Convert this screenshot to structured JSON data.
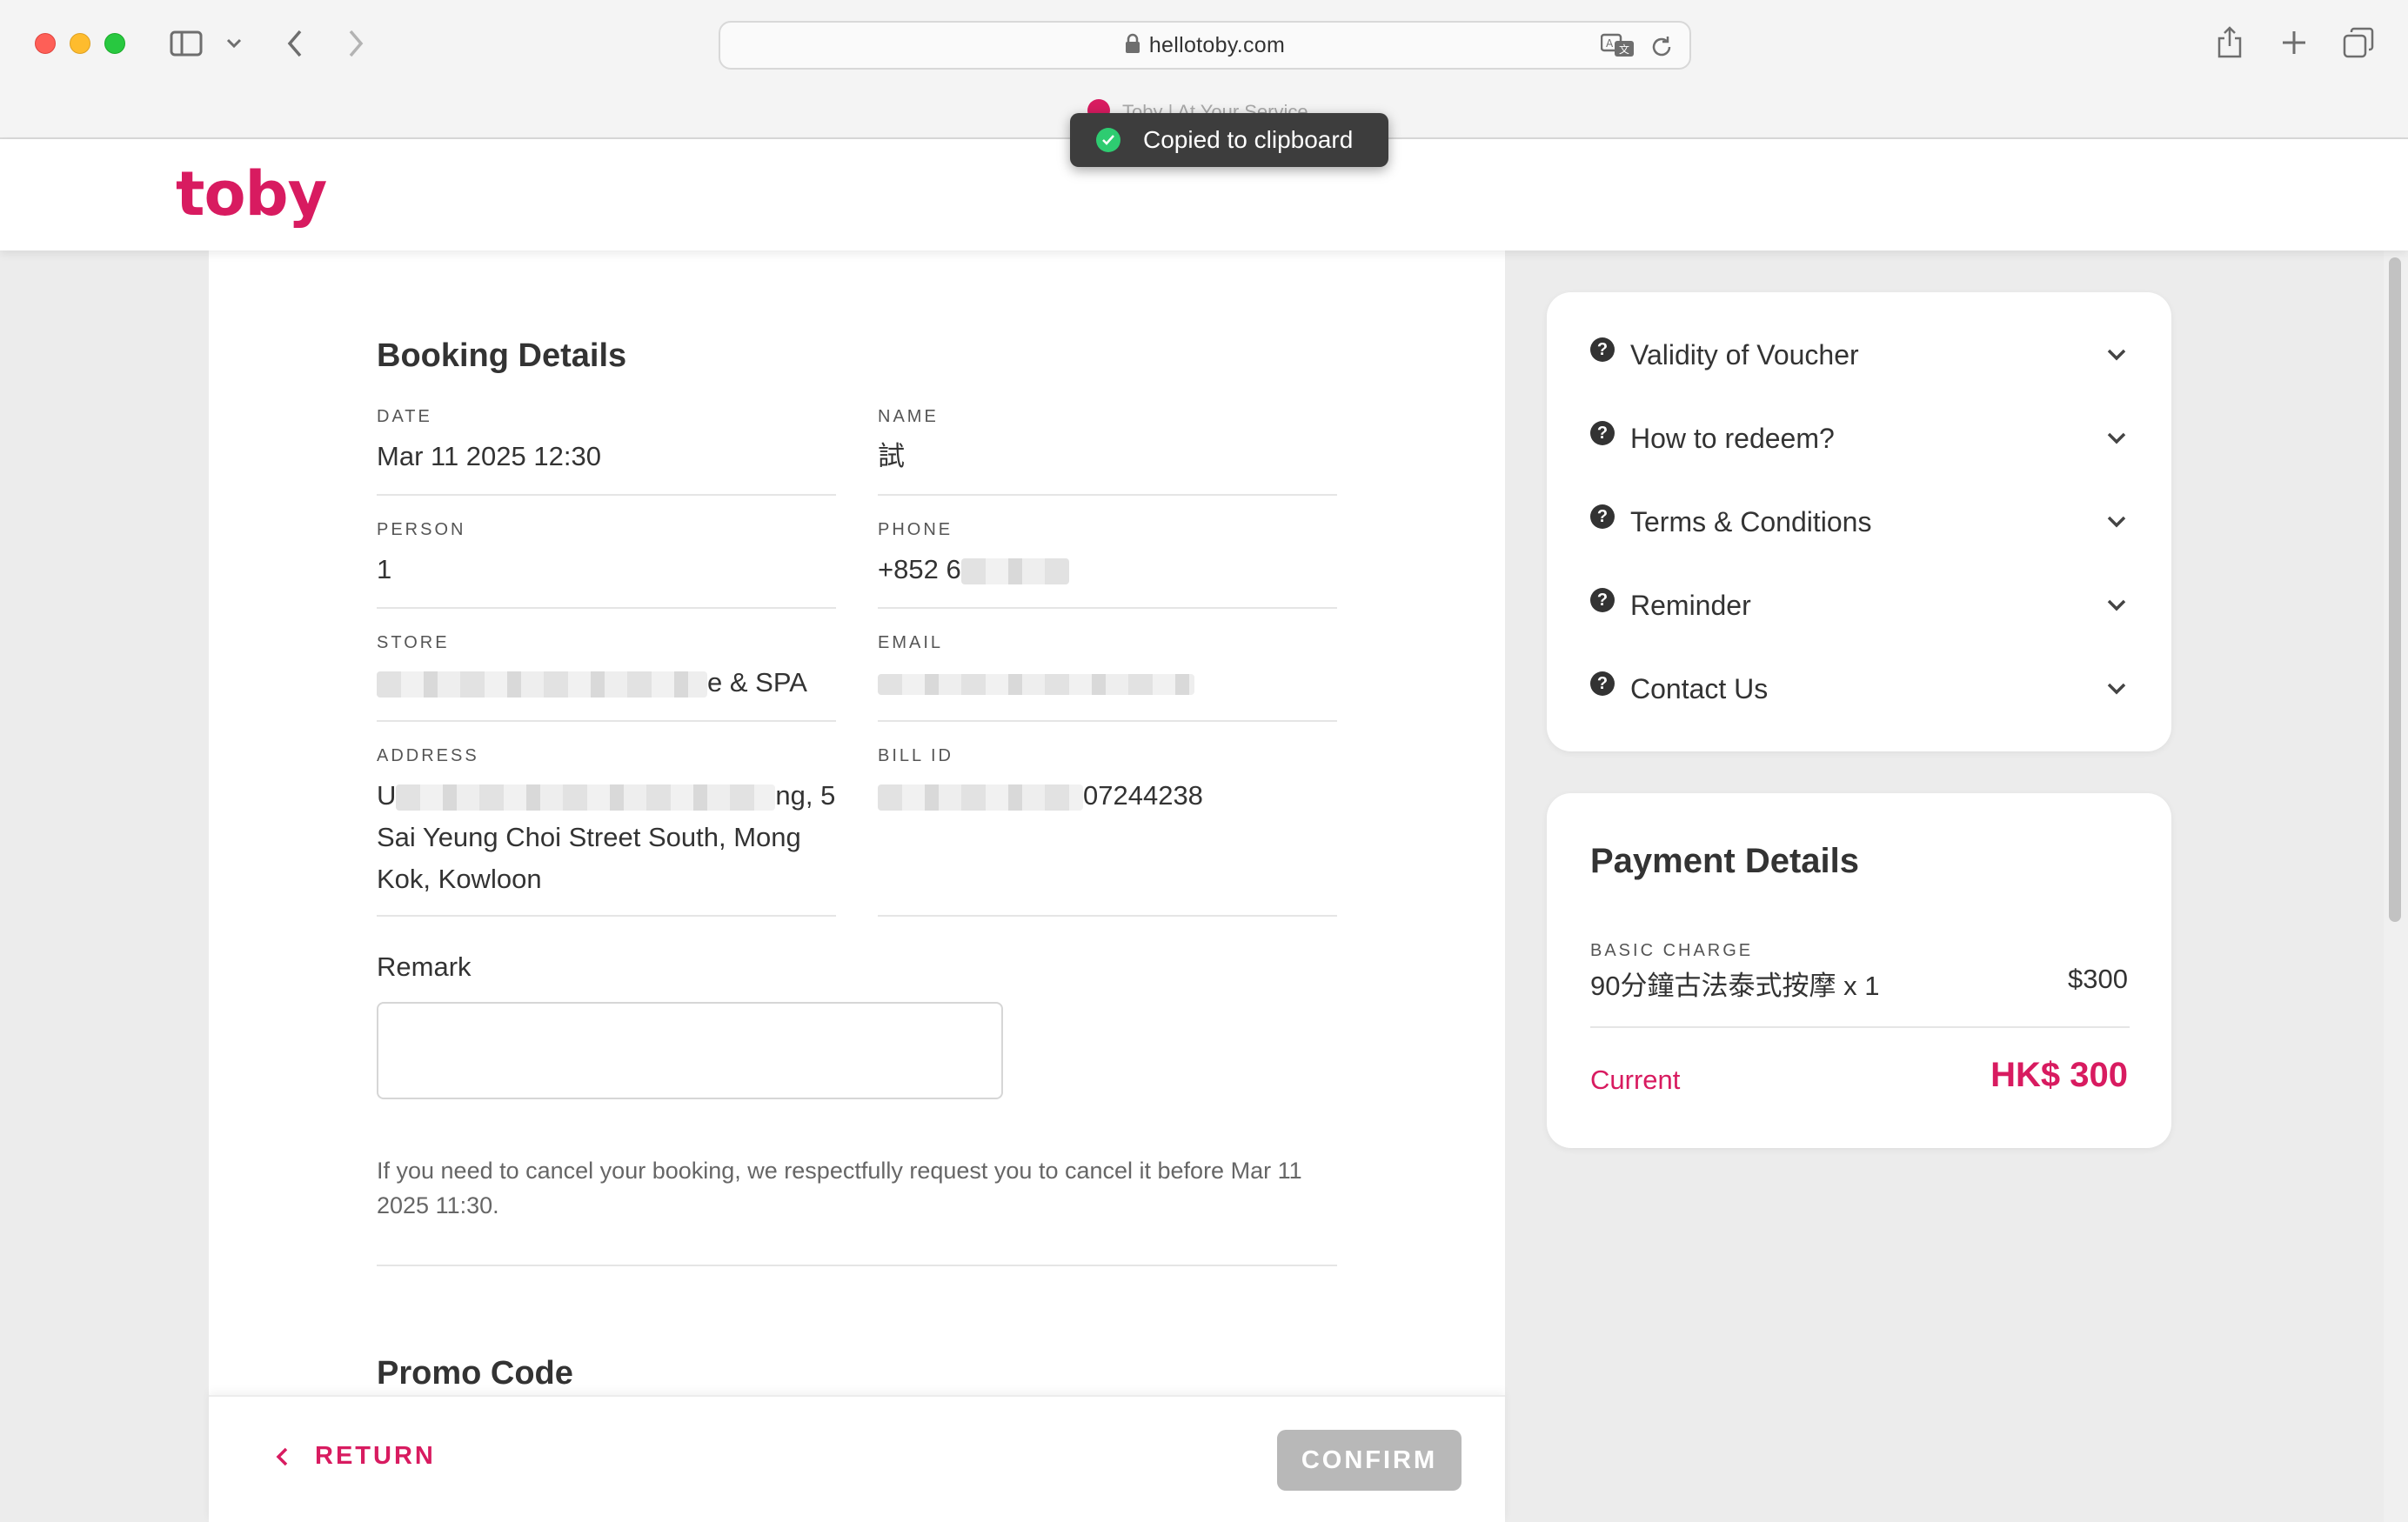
{
  "browser": {
    "url": "hellotoby.com",
    "tab_title": "Toby | At Your Service"
  },
  "toast": {
    "message": "Copied to clipboard"
  },
  "brand": {
    "logo": "toby",
    "accent": "#d81b60"
  },
  "booking": {
    "title": "Booking Details",
    "fields": {
      "date": {
        "label": "DATE",
        "value": "Mar 11 2025 12:30"
      },
      "name": {
        "label": "NAME",
        "value": "試"
      },
      "person": {
        "label": "PERSON",
        "value": "1"
      },
      "phone": {
        "label": "PHONE",
        "value": "+852 6"
      },
      "store": {
        "label": "STORE",
        "value": "e & SPA"
      },
      "email": {
        "label": "EMAIL",
        "value": ""
      },
      "address": {
        "label": "ADDRESS",
        "value_line1_end": "ng, 5",
        "value_prefix": "U",
        "value_rest": "Sai Yeung Choi Street South, Mong Kok, Kowloon"
      },
      "bill_id": {
        "label": "BILL ID",
        "value": "07244238"
      }
    },
    "remark_label": "Remark",
    "remark_value": "",
    "cancel_note": "If you need to cancel your booking, we respectfully request you to cancel it before Mar 11 2025 11:30.",
    "promo_title": "Promo Code"
  },
  "footer": {
    "return_label": "RETURN",
    "confirm_label": "CONFIRM"
  },
  "faq": {
    "items": [
      {
        "label": "Validity of Voucher"
      },
      {
        "label": "How to redeem?"
      },
      {
        "label": "Terms & Conditions"
      },
      {
        "label": "Reminder"
      },
      {
        "label": "Contact Us"
      }
    ]
  },
  "payment": {
    "title": "Payment Details",
    "basic_charge_label": "BASIC CHARGE",
    "item": "90分鐘古法泰式按摩 x 1",
    "item_amount": "$300",
    "current_label": "Current",
    "current_total": "HK$ 300"
  }
}
